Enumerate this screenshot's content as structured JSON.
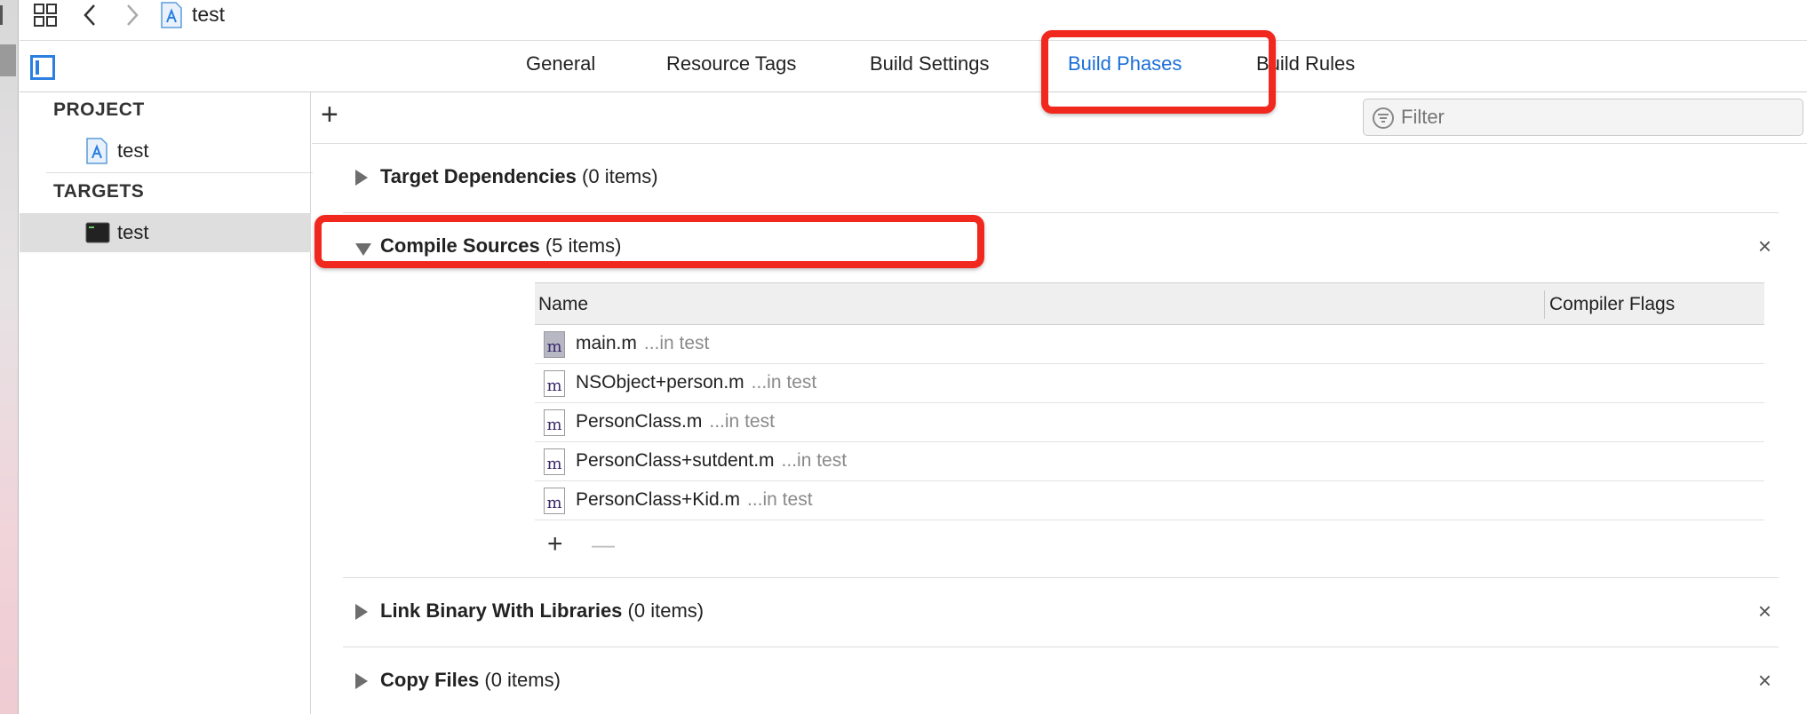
{
  "titlebar": {
    "file_name": "test"
  },
  "tabs": [
    {
      "label": "General"
    },
    {
      "label": "Resource Tags"
    },
    {
      "label": "Build Settings"
    },
    {
      "label": "Build Phases",
      "active": true
    },
    {
      "label": "Build Rules"
    }
  ],
  "sidebar": {
    "project_header": "PROJECT",
    "project_item": "test",
    "targets_header": "TARGETS",
    "target_item": "test"
  },
  "toolbar": {
    "add_symbol": "+",
    "filter_placeholder": "Filter"
  },
  "phases": [
    {
      "name": "Target Dependencies",
      "count": "(0 items)",
      "expanded": false
    },
    {
      "name": "Compile Sources",
      "count": "(5 items)",
      "expanded": true
    },
    {
      "name": "Link Binary With Libraries",
      "count": "(0 items)",
      "expanded": false
    },
    {
      "name": "Copy Files",
      "count": "(0 items)",
      "expanded": false
    }
  ],
  "close_symbol": "×",
  "compile_table": {
    "columns": [
      "Name",
      "Compiler Flags"
    ],
    "icon_glyph": "m",
    "rows": [
      {
        "name": "main.m",
        "location": "...in test"
      },
      {
        "name": "NSObject+person.m",
        "location": "...in test"
      },
      {
        "name": "PersonClass.m",
        "location": "...in test"
      },
      {
        "name": "PersonClass+sutdent.m",
        "location": "...in test"
      },
      {
        "name": "PersonClass+Kid.m",
        "location": "...in test"
      }
    ],
    "add_symbol": "+",
    "remove_symbol": "—"
  },
  "colors": {
    "accent": "#1a6fd6",
    "highlight": "#f0281e",
    "selection": "#dedede"
  }
}
